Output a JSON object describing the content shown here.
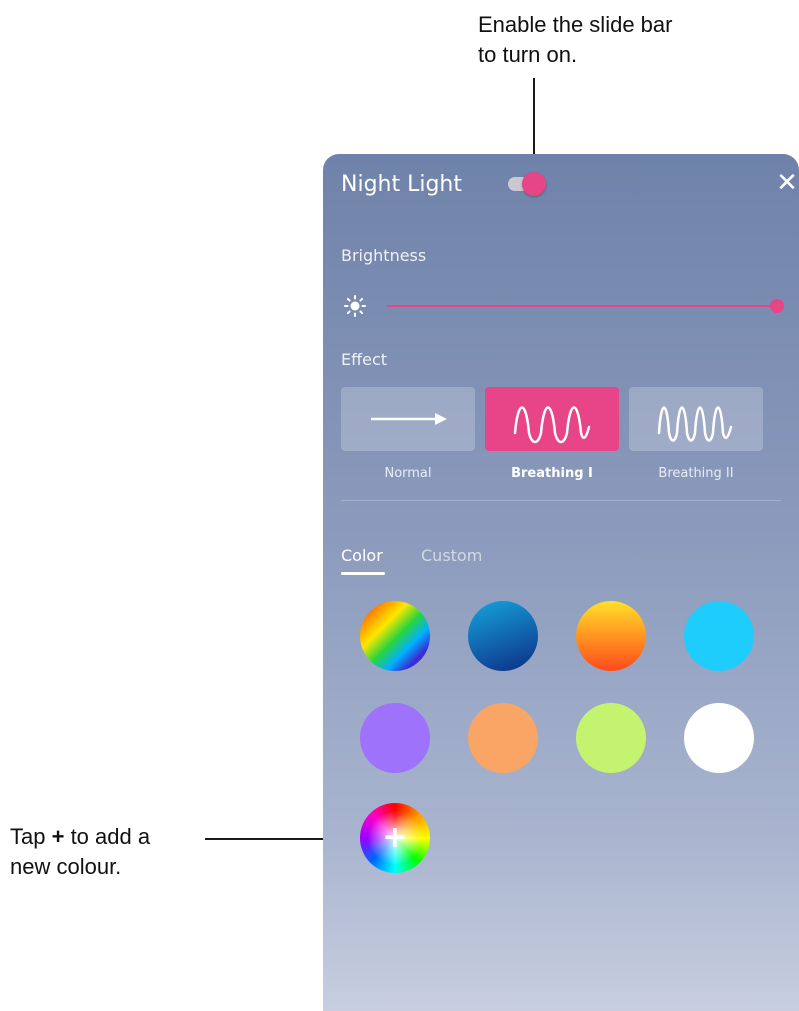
{
  "annotations": {
    "top": {
      "line1": "Enable the slide bar",
      "line2": "to turn on."
    },
    "left": {
      "pre": "Tap ",
      "plus": "+",
      "post": " to add a",
      "line2": "new colour."
    }
  },
  "panel": {
    "title": "Night Light",
    "toggle_on": true,
    "close_icon": "close-icon",
    "brightness": {
      "label": "Brightness",
      "value_percent": 100
    },
    "effect": {
      "label": "Effect",
      "options": [
        {
          "label": "Normal",
          "icon": "arrow-right-icon",
          "selected": false
        },
        {
          "label": "Breathing I",
          "icon": "wave-icon",
          "selected": true
        },
        {
          "label": "Breathing II",
          "icon": "wave-dense-icon",
          "selected": false
        }
      ]
    },
    "tabs": [
      {
        "label": "Color",
        "active": true
      },
      {
        "label": "Custom",
        "active": false
      }
    ],
    "swatches": [
      {
        "name": "rainbow",
        "style": "rainbow-stripes"
      },
      {
        "name": "blue-gradient",
        "colors": [
          "#14a5db",
          "#0e2d86"
        ]
      },
      {
        "name": "sunset-gradient",
        "colors": [
          "#ffe028",
          "#ff4a1c"
        ]
      },
      {
        "name": "cyan",
        "colors": [
          "#1ecdfb"
        ]
      },
      {
        "name": "purple",
        "colors": [
          "#9f72fb"
        ]
      },
      {
        "name": "orange",
        "colors": [
          "#f9a565"
        ]
      },
      {
        "name": "lime",
        "colors": [
          "#c4f46f"
        ]
      },
      {
        "name": "white",
        "colors": [
          "#ffffff"
        ]
      }
    ],
    "add_button": {
      "icon": "plus-icon",
      "label": "+"
    }
  },
  "colors": {
    "accent": "#e84488",
    "toggle_track": "#c9c9d4"
  }
}
